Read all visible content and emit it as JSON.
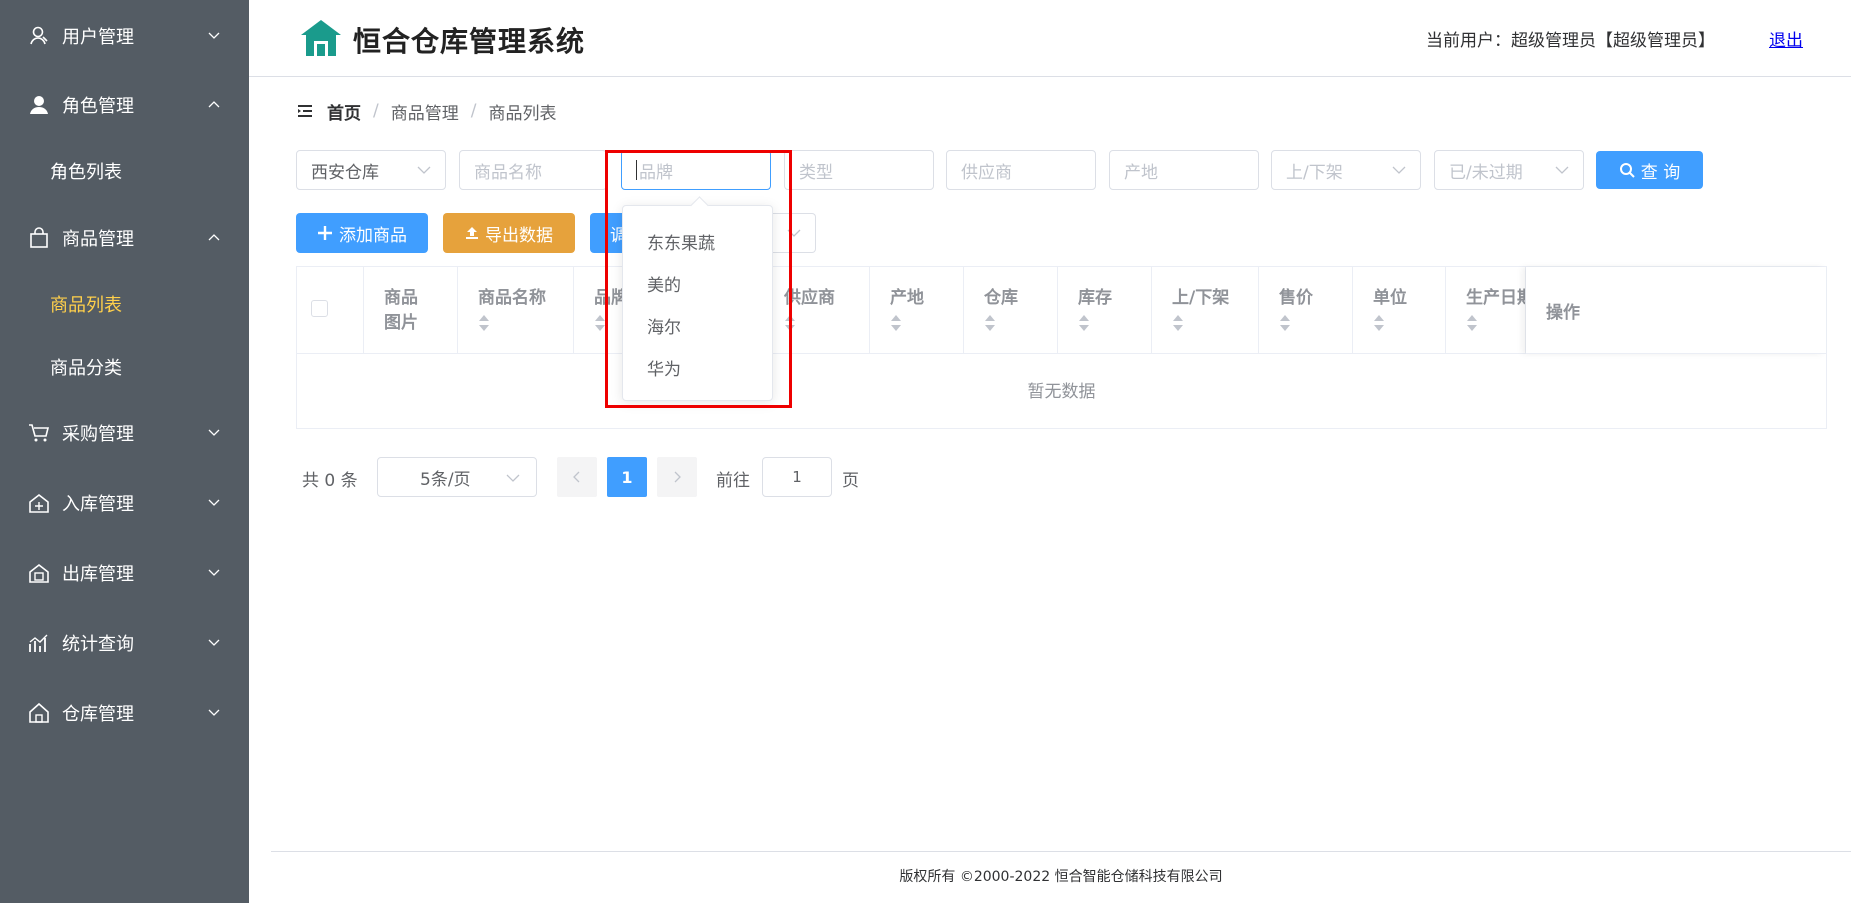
{
  "sidebar": {
    "bg_color": "#545c64",
    "active_color": "#ffd04b",
    "menus": [
      {
        "label": "用户管理",
        "icon": "user-outline-icon",
        "expanded": false
      },
      {
        "label": "角色管理",
        "icon": "user-filled-icon",
        "expanded": true
      },
      {
        "label": "商品管理",
        "icon": "shopping-bag-icon",
        "expanded": true
      },
      {
        "label": "采购管理",
        "icon": "shopping-cart-icon",
        "expanded": false
      },
      {
        "label": "入库管理",
        "icon": "warehouse-in-icon",
        "expanded": false
      },
      {
        "label": "出库管理",
        "icon": "warehouse-out-icon",
        "expanded": false
      },
      {
        "label": "统计查询",
        "icon": "chart-icon",
        "expanded": false
      },
      {
        "label": "仓库管理",
        "icon": "house-icon",
        "expanded": false
      }
    ],
    "sub_items": {
      "role_list": "角色列表",
      "product_list": "商品列表",
      "product_category": "商品分类"
    }
  },
  "header": {
    "title": "恒合仓库管理系统",
    "user_text": "当前用户：超级管理员【超级管理员】",
    "logout": "退出"
  },
  "breadcrumb": {
    "home": "首页",
    "items": [
      "商品管理",
      "商品列表"
    ],
    "separator": "/"
  },
  "filters": {
    "warehouse": "西安仓库",
    "name_placeholder": "商品名称",
    "brand_placeholder": "品牌",
    "type_placeholder": "类型",
    "supplier_placeholder": "供应商",
    "origin_placeholder": "产地",
    "shelf_placeholder": "上/下架",
    "expire_placeholder": "已/未过期",
    "search_label": "查 询"
  },
  "toolbar": {
    "add_label": "添加商品",
    "export_label": "导出数据",
    "third_label": "调"
  },
  "brand_dropdown": {
    "options": [
      "东东果蔬",
      "美的",
      "海尔",
      "华为"
    ]
  },
  "table": {
    "columns": [
      {
        "line1": "商品",
        "line2": "图片"
      },
      {
        "line1": "商品名称"
      },
      {
        "line1": "品牌"
      },
      {
        "line1": "供应商"
      },
      {
        "line1": "产地"
      },
      {
        "line1": "仓库"
      },
      {
        "line1": "库存"
      },
      {
        "line1": "上/下架"
      },
      {
        "line1": "售价"
      },
      {
        "line1": "单位"
      },
      {
        "line1": "生产日期"
      },
      {
        "line1": "操作"
      }
    ],
    "empty_text": "暂无数据"
  },
  "pagination": {
    "total": "共 0 条",
    "page_size": "5条/页",
    "current_page": "1",
    "goto_label": "前往",
    "goto_value": "1",
    "page_suffix": "页"
  },
  "footer": {
    "text": "版权所有 ©2000-2022  恒合智能仓储科技有限公司"
  },
  "colors": {
    "primary": "#409eff",
    "warning": "#e6a23c",
    "highlight": "#ee0000",
    "logo": "#1a9b8c"
  }
}
